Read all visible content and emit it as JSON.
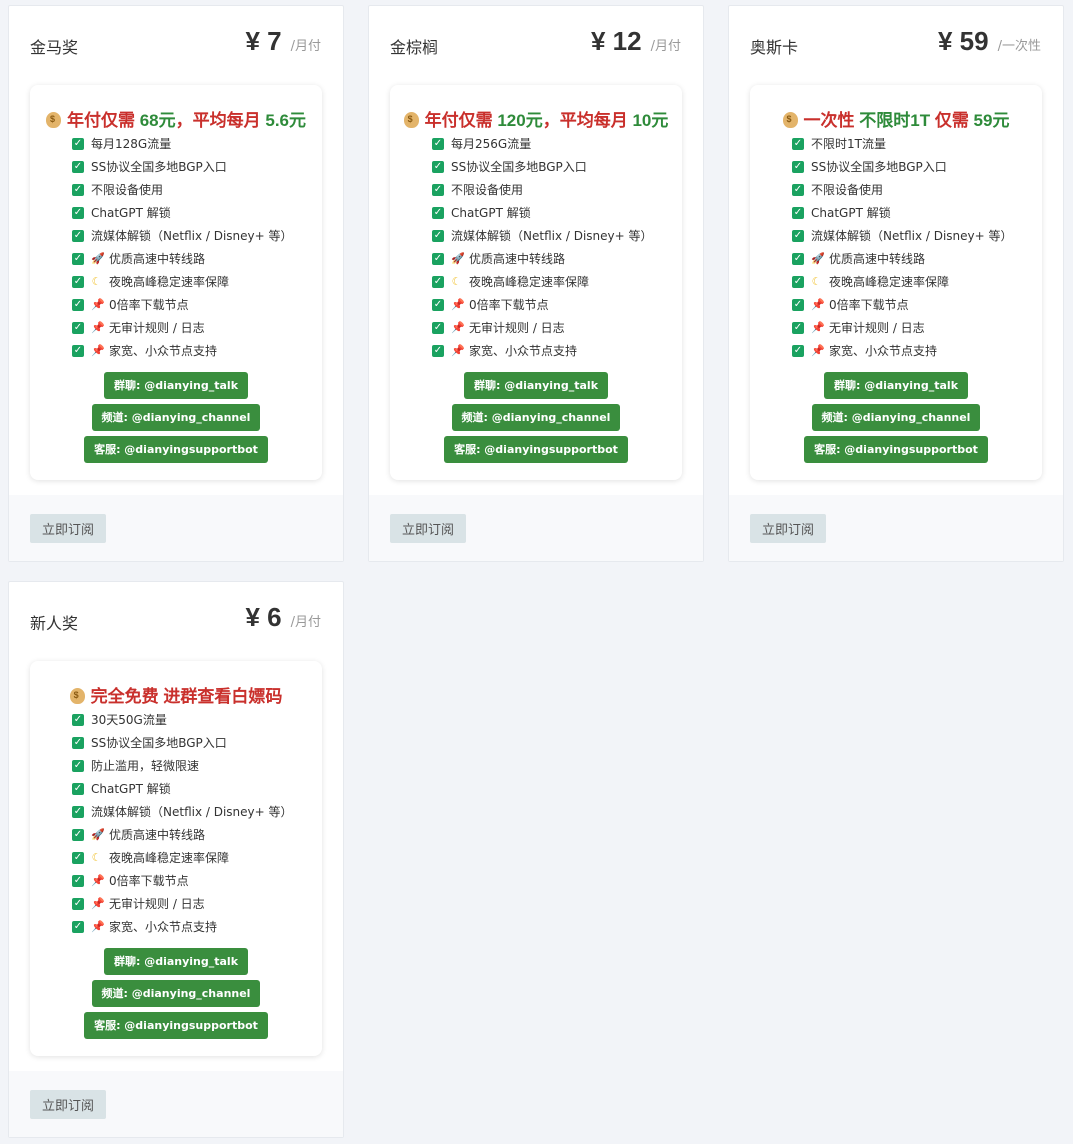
{
  "plans": [
    {
      "name": "金马奖",
      "price": "¥ 7",
      "unit": "/月付",
      "headline": [
        {
          "text": "年付仅需 ",
          "color": "red"
        },
        {
          "text": "68元",
          "color": "green"
        },
        {
          "text": "，平均每月 ",
          "color": "red"
        },
        {
          "text": "5.6元",
          "color": "green"
        }
      ],
      "features": [
        {
          "icon": "check",
          "text": "每月128G流量"
        },
        {
          "icon": "check",
          "text": "SS协议全国多地BGP入口"
        },
        {
          "icon": "check",
          "text": "不限设备使用"
        },
        {
          "icon": "check",
          "text": "ChatGPT 解锁"
        },
        {
          "icon": "check",
          "text": "流媒体解锁（Netflix / Disney+ 等）"
        },
        {
          "icon": "rocket",
          "text": "优质高速中转线路"
        },
        {
          "icon": "moon",
          "text": "夜晚高峰稳定速率保障"
        },
        {
          "icon": "pin",
          "text": "0倍率下载节点"
        },
        {
          "icon": "pin",
          "text": "无审计规则 / 日志"
        },
        {
          "icon": "pin",
          "text": "家宽、小众节点支持"
        }
      ],
      "links": [
        "群聊: @dianying_talk",
        "频道: @dianying_channel",
        "客服: @dianyingsupportbot"
      ],
      "button": "立即订阅"
    },
    {
      "name": "金棕榈",
      "price": "¥ 12",
      "unit": "/月付",
      "headline": [
        {
          "text": "年付仅需 ",
          "color": "red"
        },
        {
          "text": "120元",
          "color": "green"
        },
        {
          "text": "，平均每月 ",
          "color": "red"
        },
        {
          "text": "10元",
          "color": "green"
        }
      ],
      "features": [
        {
          "icon": "check",
          "text": "每月256G流量"
        },
        {
          "icon": "check",
          "text": "SS协议全国多地BGP入口"
        },
        {
          "icon": "check",
          "text": "不限设备使用"
        },
        {
          "icon": "check",
          "text": "ChatGPT 解锁"
        },
        {
          "icon": "check",
          "text": "流媒体解锁（Netflix / Disney+ 等）"
        },
        {
          "icon": "rocket",
          "text": "优质高速中转线路"
        },
        {
          "icon": "moon",
          "text": "夜晚高峰稳定速率保障"
        },
        {
          "icon": "pin",
          "text": "0倍率下载节点"
        },
        {
          "icon": "pin",
          "text": "无审计规则 / 日志"
        },
        {
          "icon": "pin",
          "text": "家宽、小众节点支持"
        }
      ],
      "links": [
        "群聊: @dianying_talk",
        "频道: @dianying_channel",
        "客服: @dianyingsupportbot"
      ],
      "button": "立即订阅"
    },
    {
      "name": "奥斯卡",
      "price": "¥ 59",
      "unit": "/一次性",
      "headline": [
        {
          "text": "一次性 ",
          "color": "red"
        },
        {
          "text": "不限时1T",
          "color": "green"
        },
        {
          "text": " 仅需 ",
          "color": "red"
        },
        {
          "text": "59元",
          "color": "green"
        }
      ],
      "features": [
        {
          "icon": "check",
          "text": "不限时1T流量"
        },
        {
          "icon": "check",
          "text": "SS协议全国多地BGP入口"
        },
        {
          "icon": "check",
          "text": "不限设备使用"
        },
        {
          "icon": "check",
          "text": "ChatGPT 解锁"
        },
        {
          "icon": "check",
          "text": "流媒体解锁（Netflix / Disney+ 等）"
        },
        {
          "icon": "rocket",
          "text": "优质高速中转线路"
        },
        {
          "icon": "moon",
          "text": "夜晚高峰稳定速率保障"
        },
        {
          "icon": "pin",
          "text": "0倍率下载节点"
        },
        {
          "icon": "pin",
          "text": "无审计规则 / 日志"
        },
        {
          "icon": "pin",
          "text": "家宽、小众节点支持"
        }
      ],
      "links": [
        "群聊: @dianying_talk",
        "频道: @dianying_channel",
        "客服: @dianyingsupportbot"
      ],
      "button": "立即订阅"
    },
    {
      "name": "新人奖",
      "price": "¥ 6",
      "unit": "/月付",
      "headline": [
        {
          "text": "完全免费 进群查看白嫖码",
          "color": "red"
        }
      ],
      "features": [
        {
          "icon": "check",
          "text": "30天50G流量"
        },
        {
          "icon": "check",
          "text": "SS协议全国多地BGP入口"
        },
        {
          "icon": "check",
          "text": "防止滥用，轻微限速"
        },
        {
          "icon": "check",
          "text": "ChatGPT 解锁"
        },
        {
          "icon": "check",
          "text": "流媒体解锁（Netflix / Disney+ 等）"
        },
        {
          "icon": "rocket",
          "text": "优质高速中转线路"
        },
        {
          "icon": "moon",
          "text": "夜晚高峰稳定速率保障"
        },
        {
          "icon": "pin",
          "text": "0倍率下载节点"
        },
        {
          "icon": "pin",
          "text": "无审计规则 / 日志"
        },
        {
          "icon": "pin",
          "text": "家宽、小众节点支持"
        }
      ],
      "links": [
        "群聊: @dianying_talk",
        "频道: @dianying_channel",
        "客服: @dianyingsupportbot"
      ],
      "button": "立即订阅"
    }
  ],
  "colors": {
    "red": "#c9302c",
    "green": "#2e8b3a",
    "tag": "#3a8e3e",
    "check": "#1aa260"
  }
}
